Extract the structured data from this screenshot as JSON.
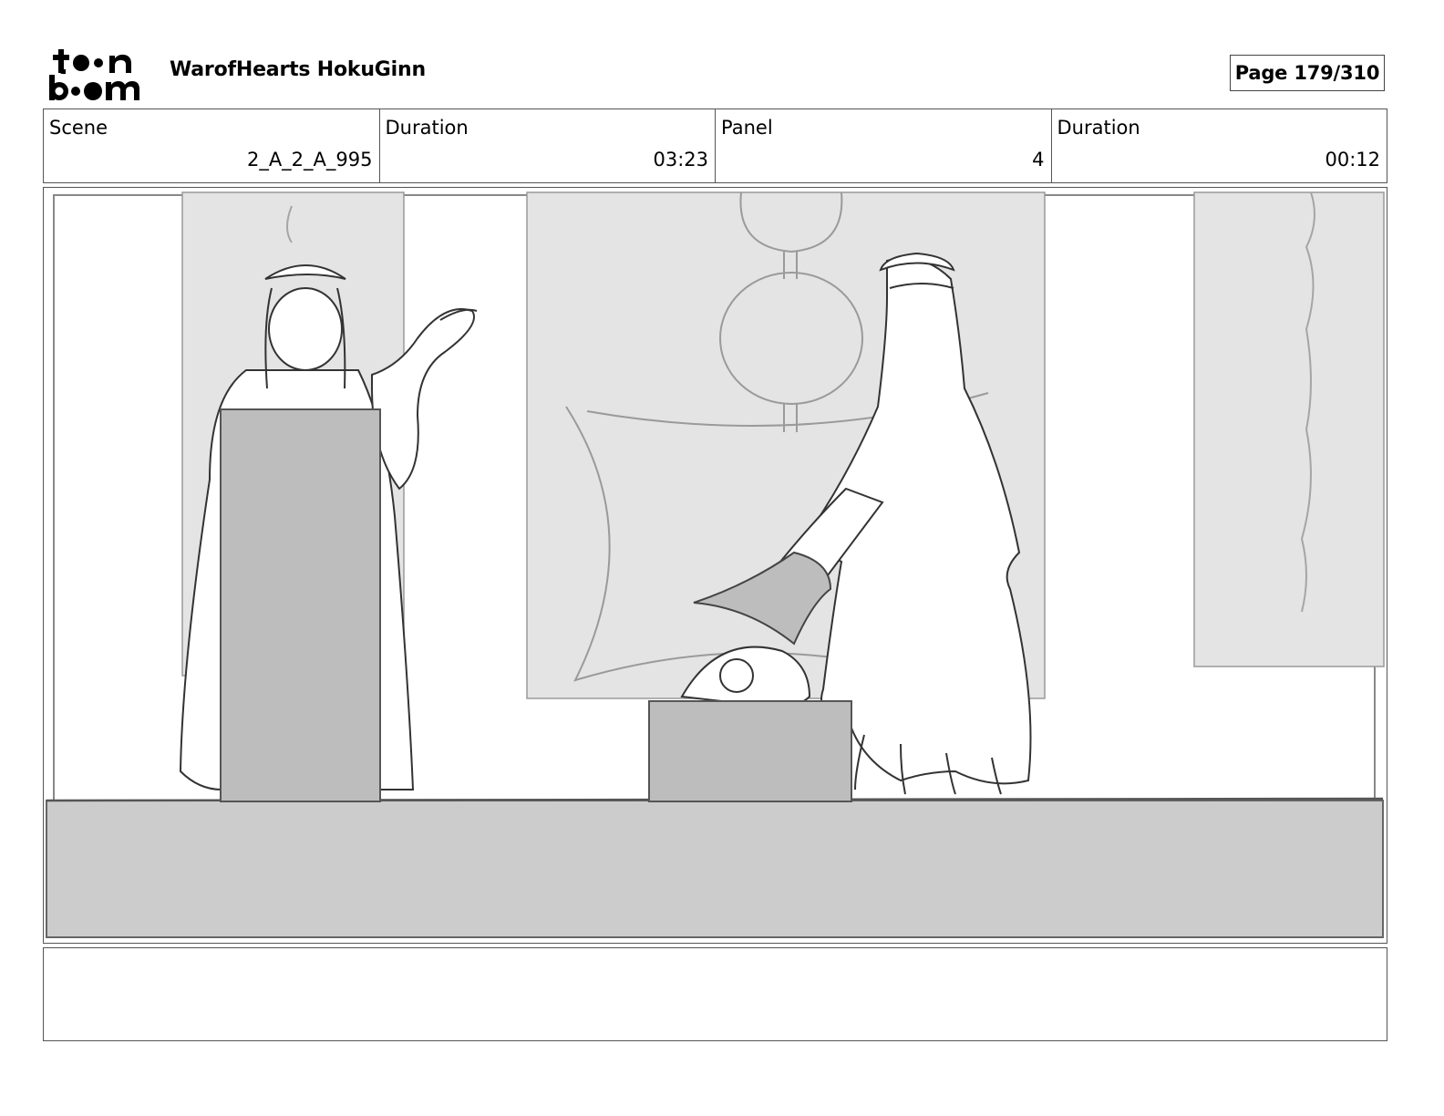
{
  "header": {
    "logo_text_top": "toon",
    "logo_text_bottom": "boom",
    "project_title": "WarofHearts HokuGinn",
    "page_indicator": "Page 179/310"
  },
  "info": {
    "scene_label": "Scene",
    "scene_value": "2_A_2_A_995",
    "scene_duration_label": "Duration",
    "scene_duration_value": "03:23",
    "panel_label": "Panel",
    "panel_value": "4",
    "panel_duration_label": "Duration",
    "panel_duration_value": "00:12"
  },
  "notes": {
    "text": ""
  }
}
